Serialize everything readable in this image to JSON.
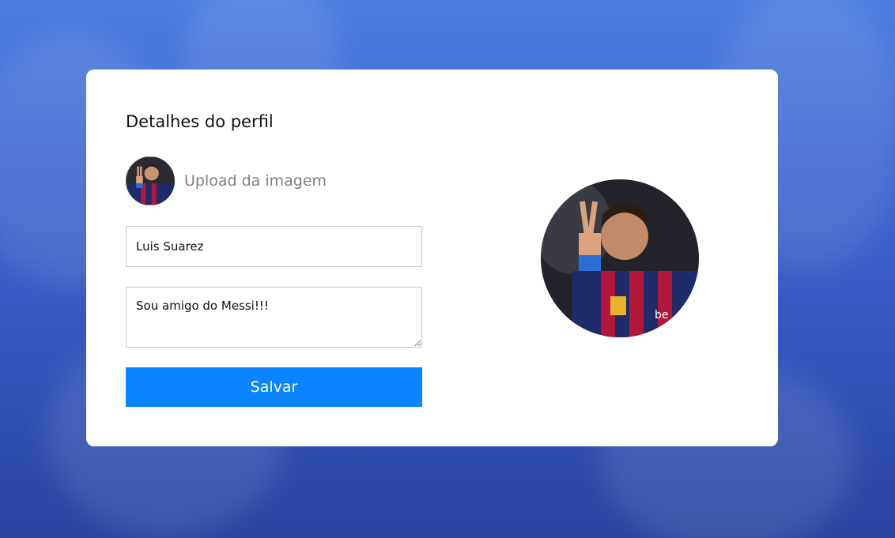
{
  "profile": {
    "title": "Detalhes do perfil",
    "upload_label": "Upload da imagem",
    "avatar_icon": "profile-photo",
    "name_value": "Luis Suarez",
    "bio_value": "Sou amigo do Messi!!!",
    "save_label": "Salvar"
  },
  "colors": {
    "accent": "#0a84ff",
    "background": "#3e68d2",
    "card": "#ffffff"
  }
}
